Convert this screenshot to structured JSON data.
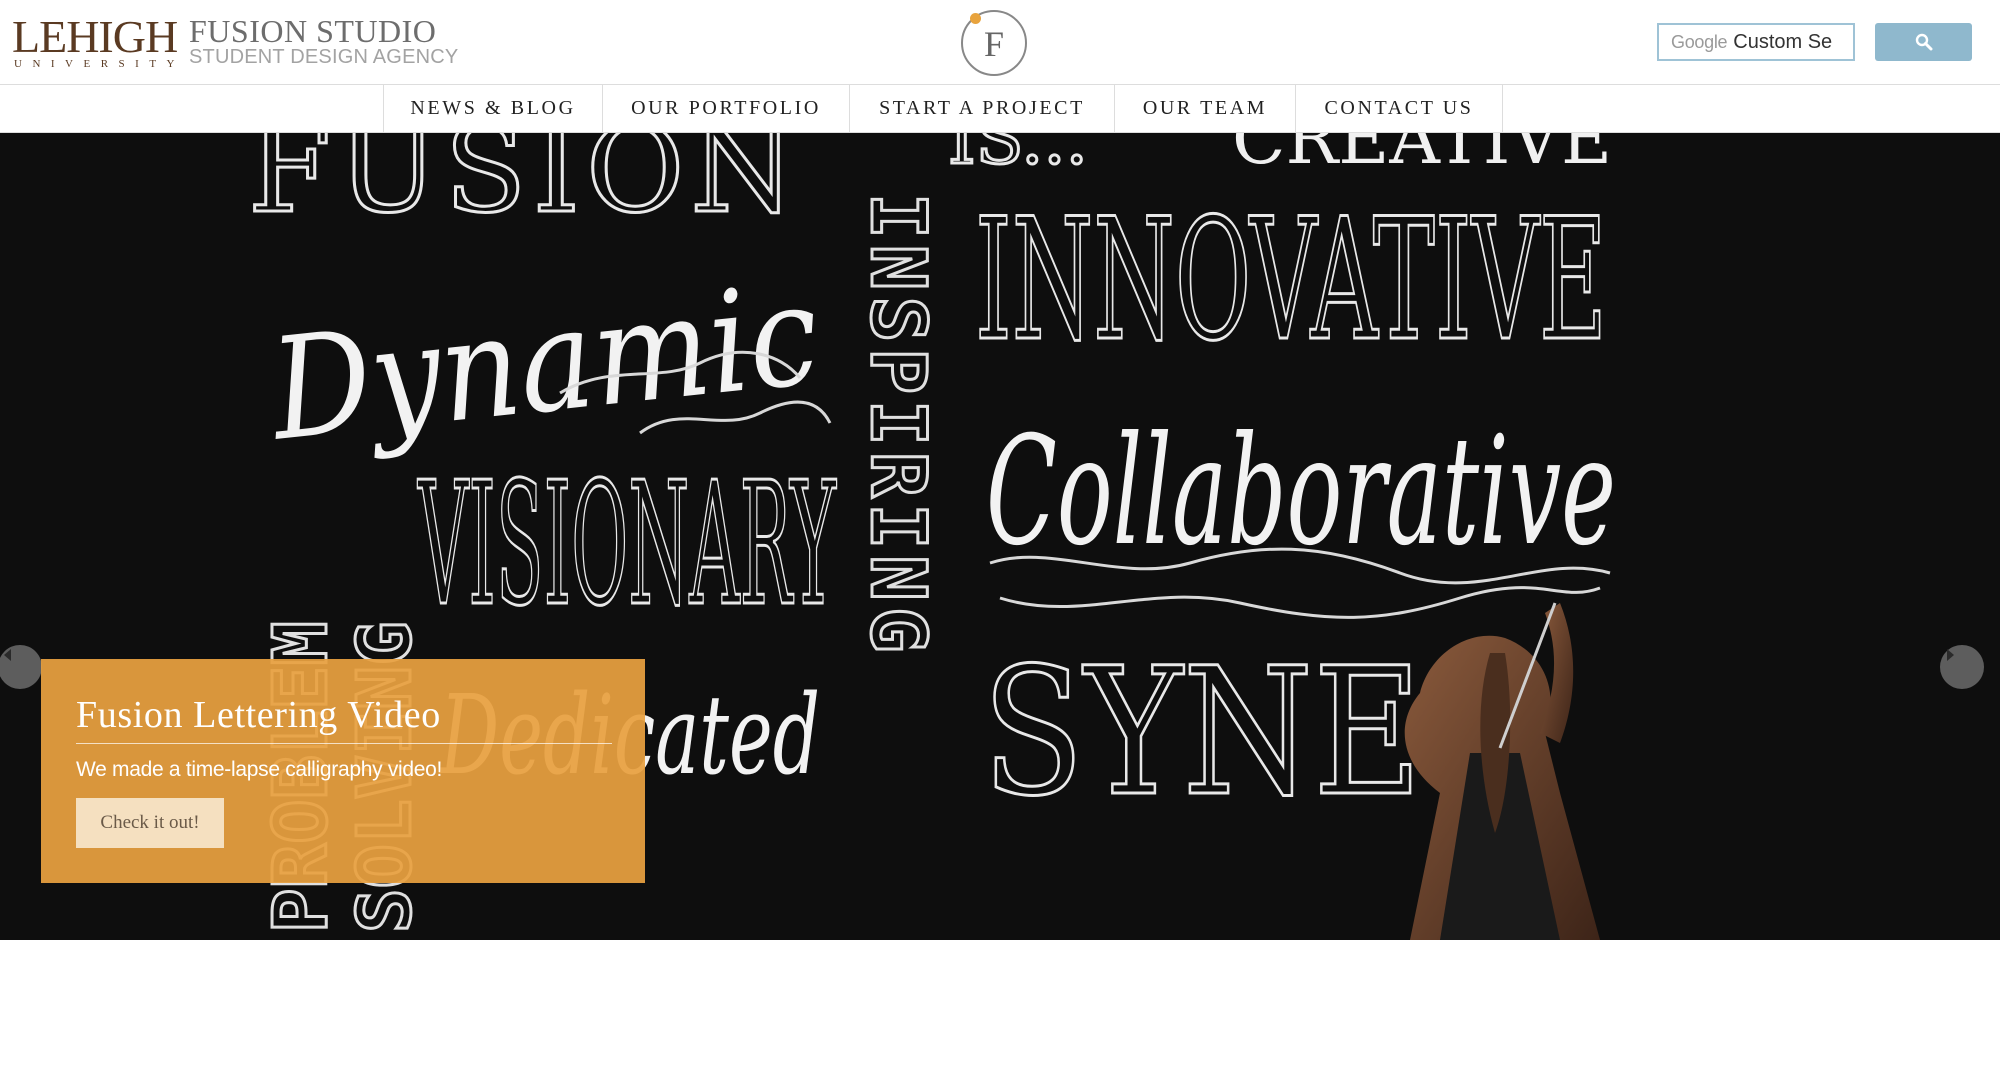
{
  "header": {
    "lehigh_name": "LEHIGH",
    "lehigh_sub": "UNIVERSITY",
    "studio_name": "FUSION STUDIO",
    "studio_tagline": "STUDENT DESIGN AGENCY",
    "logo_letter": "F",
    "search": {
      "brand": "Google",
      "value": "Custom Se",
      "button_icon": "search-icon"
    }
  },
  "nav": {
    "items": [
      {
        "label": "NEWS & BLOG"
      },
      {
        "label": "OUR PORTFOLIO"
      },
      {
        "label": "START A PROJECT"
      },
      {
        "label": "OUR TEAM"
      },
      {
        "label": "CONTACT US"
      }
    ]
  },
  "hero": {
    "artwork_words": [
      "FUSION",
      "IS...",
      "CREATIVE",
      "Dynamic",
      "INSPIRING",
      "INNOVATIVE",
      "PROBLEM",
      "SOLVING",
      "VISIONARY",
      "Collaborative",
      "Dedicated",
      "SYNE"
    ],
    "prev_icon": "chevron-left-icon",
    "next_icon": "chevron-right-icon",
    "caption": {
      "title": "Fusion Lettering Video",
      "text": "We made a time-lapse calligraphy video!",
      "button_label": "Check it out!"
    }
  },
  "colors": {
    "brand_brown": "#5a3a22",
    "accent_orange": "#e8a040",
    "search_blue": "#8fb8cd",
    "chalkboard": "#0d0d0d"
  }
}
